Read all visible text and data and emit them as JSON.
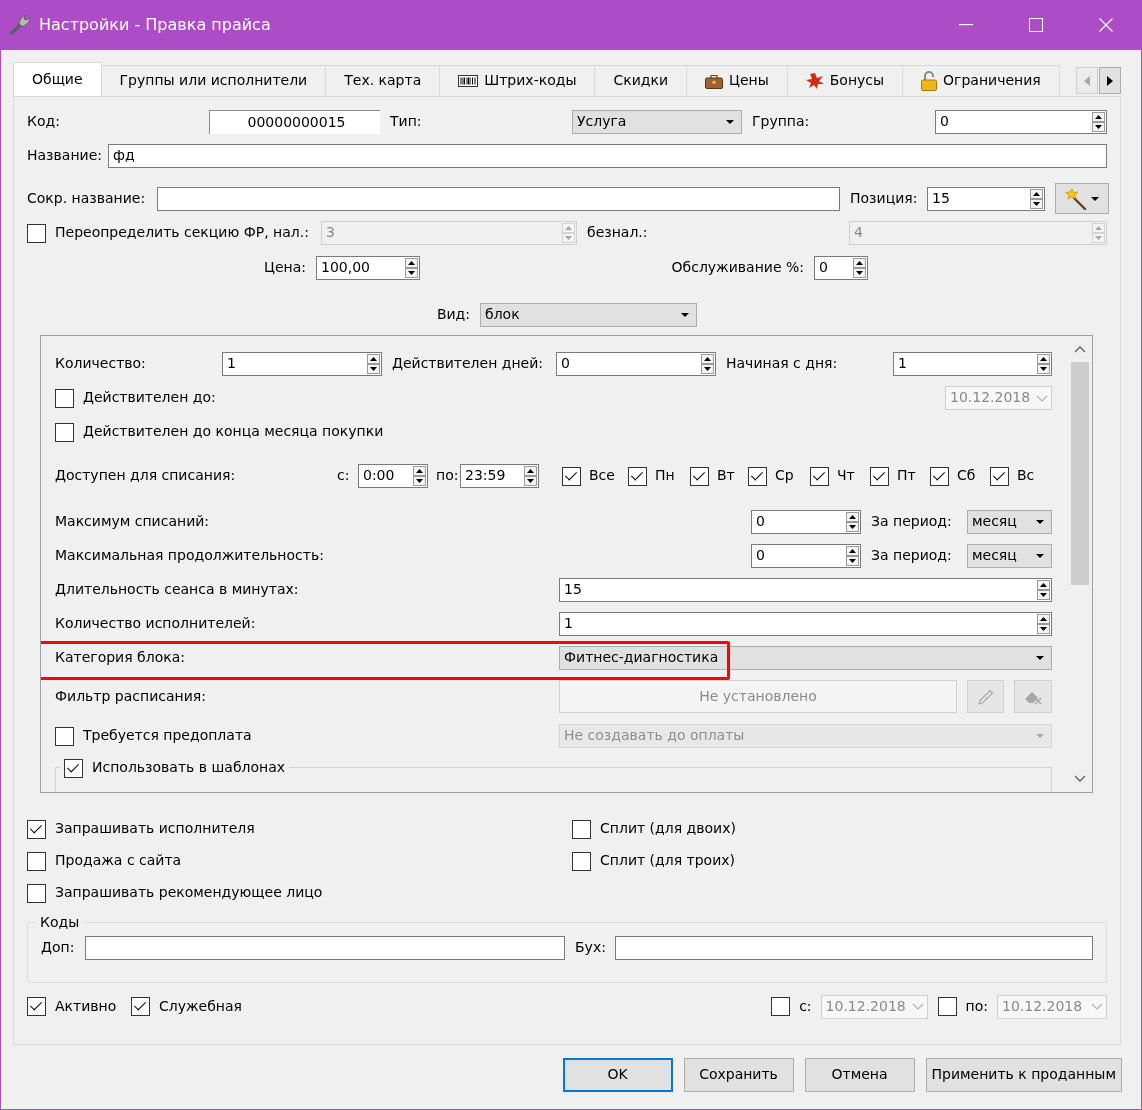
{
  "window": {
    "title": "Настройки - Правка прайса"
  },
  "tabs": [
    {
      "label": "Общие",
      "kind": "text",
      "selected": true
    },
    {
      "label": "Группы или исполнители",
      "kind": "text",
      "selected": false
    },
    {
      "label": "Тех. карта",
      "kind": "text",
      "selected": false
    },
    {
      "label": "Штрих-коды",
      "kind": "barcode",
      "selected": false
    },
    {
      "label": "Скидки",
      "kind": "text",
      "selected": false
    },
    {
      "label": "Цены",
      "kind": "case",
      "selected": false
    },
    {
      "label": "Бонусы",
      "kind": "bonus",
      "selected": false
    },
    {
      "label": "Ограничения",
      "kind": "lock",
      "selected": false
    }
  ],
  "tab_scroll": {
    "back_disabled": true,
    "forward_disabled": false
  },
  "general": {
    "code": {
      "label": "Код:",
      "value": "00000000015"
    },
    "type": {
      "label": "Тип:",
      "value": "Услуга"
    },
    "group": {
      "label": "Группа:",
      "value": "0"
    },
    "name": {
      "label": "Название:",
      "value": "фд"
    },
    "short_name": {
      "label": "Сокр. название:"
    },
    "position": {
      "label": "Позиция:",
      "value": "15"
    },
    "override_section": {
      "label": "Переопределить секцию ФР, нал.:",
      "checked": false,
      "value": "3"
    },
    "cashless": {
      "label": "безнал.:",
      "value": "4"
    },
    "price": {
      "label": "Цена:",
      "value": "100,00"
    },
    "service_percent": {
      "label": "Обслуживание %:",
      "value": "0"
    },
    "view": {
      "label": "Вид:",
      "value": "блок"
    }
  },
  "block": {
    "quantity": {
      "label": "Количество:",
      "value": "1"
    },
    "valid_days": {
      "label": "Действителен дней:",
      "value": "0"
    },
    "start_day": {
      "label": "Начиная с дня:",
      "value": "1"
    },
    "valid_until": {
      "label": "Действителен до:",
      "checked": false,
      "date": "10.12.2018"
    },
    "valid_month_end": {
      "label": "Действителен до конца месяца покупки",
      "checked": false
    },
    "availability": {
      "label": "Доступен для списания:",
      "from_label": "с:",
      "from": "0:00",
      "to_label": "по:",
      "to": "23:59",
      "days": [
        {
          "label": "Все",
          "checked": true
        },
        {
          "label": "Пн",
          "checked": true
        },
        {
          "label": "Вт",
          "checked": true
        },
        {
          "label": "Ср",
          "checked": true
        },
        {
          "label": "Чт",
          "checked": true
        },
        {
          "label": "Пт",
          "checked": true
        },
        {
          "label": "Сб",
          "checked": true
        },
        {
          "label": "Вс",
          "checked": true
        }
      ]
    },
    "max_writeoffs": {
      "label": "Максимум списаний:",
      "value": "0",
      "period_label": "За период:",
      "period": "месяц"
    },
    "max_duration": {
      "label": "Максимальная продолжительность:",
      "value": "0",
      "period_label": "За период:",
      "period": "месяц"
    },
    "session_minutes": {
      "label": "Длительность сеанса в минутах:",
      "value": "15"
    },
    "performers": {
      "label": "Количество исполнителей:",
      "value": "1"
    },
    "category": {
      "label": "Категория блока:",
      "value": "Фитнес-диагностика",
      "highlighted": true
    },
    "schedule_filter": {
      "label": "Фильтр расписания:",
      "value": "Не установлено",
      "disabled": true
    },
    "prepayment": {
      "label": "Требуется предоплата",
      "checked": false,
      "option": "Не создавать до оплаты"
    },
    "templates": {
      "label": "Использовать в шаблонах",
      "checked": true
    }
  },
  "options_left": [
    {
      "label": "Запрашивать исполнителя",
      "checked": true
    },
    {
      "label": "Продажа с сайта",
      "checked": false
    },
    {
      "label": "Запрашивать рекомендующее лицо",
      "checked": false
    }
  ],
  "options_right": [
    {
      "label": "Сплит (для двоих)",
      "checked": false
    },
    {
      "label": "Сплит (для троих)",
      "checked": false
    }
  ],
  "codes": {
    "title": "Коды",
    "extra_label": "Доп:",
    "accounting_label": "Бух:"
  },
  "footer": {
    "active": {
      "label": "Активно",
      "checked": true
    },
    "service": {
      "label": "Служебная",
      "checked": true
    },
    "date_from": {
      "label": "с:",
      "checked": false,
      "date": "10.12.2018"
    },
    "date_to": {
      "label": "по:",
      "checked": false,
      "date": "10.12.2018"
    }
  },
  "buttons": [
    {
      "label": "OK",
      "default": true
    },
    {
      "label": "Сохранить",
      "default": false
    },
    {
      "label": "Отмена",
      "default": false
    },
    {
      "label": "Применить к проданным",
      "default": false
    }
  ]
}
